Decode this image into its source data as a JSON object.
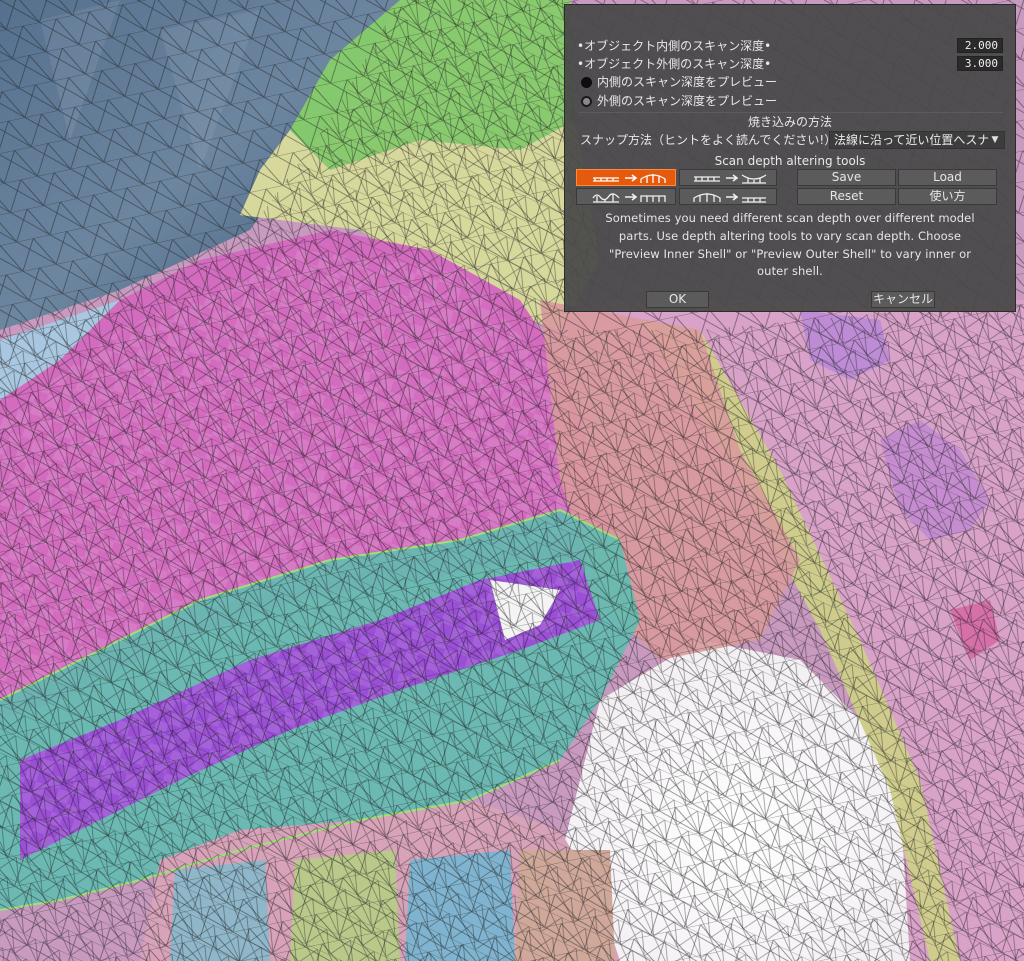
{
  "dialog": {
    "inner_depth_label": "•オブジェクト内側のスキャン深度•",
    "inner_depth_value": "2.000",
    "outer_depth_label": "•オブジェクト外側のスキャン深度•",
    "outer_depth_value": "3.000",
    "preview_inner_label": "内側のスキャン深度をプレビュー",
    "preview_outer_label": "外側のスキャン深度をプレビュー",
    "preview_selected": "inner",
    "bake_method_heading": "焼き込みの方法",
    "snap_method_label": "スナップ方法（ヒントをよく読んでください!）",
    "snap_method_value": "法線に沿って近い位置へスナ",
    "tools_heading": "Scan depth altering tools",
    "tools": [
      {
        "name": "flat-to-arch",
        "active": true
      },
      {
        "name": "flat-to-dip",
        "active": false
      },
      {
        "name": "bumps-to-arch",
        "active": false
      },
      {
        "name": "arch-to-flat",
        "active": false
      }
    ],
    "save_label": "Save",
    "load_label": "Load",
    "reset_label": "Reset",
    "usage_label": "使い方",
    "description_lines": [
      "Sometimes you need different scan depth over different model",
      "parts. Use depth altering tools to vary scan depth. Choose",
      "\"Preview Inner Shell\" or \"Preview Outer Shell\" to vary inner or",
      "outer shell."
    ],
    "ok_label": "OK",
    "cancel_label": "キャンセル"
  },
  "colors": {
    "accent": "#e55a0c",
    "panel": "#484848",
    "mesh_pink": "#d06fb8",
    "mesh_green": "#7fd36a",
    "mesh_yellow": "#d8dc96",
    "mesh_purple": "#9b52d8",
    "mesh_teal": "#5ec6b0",
    "sky": "#4b6a8a"
  }
}
